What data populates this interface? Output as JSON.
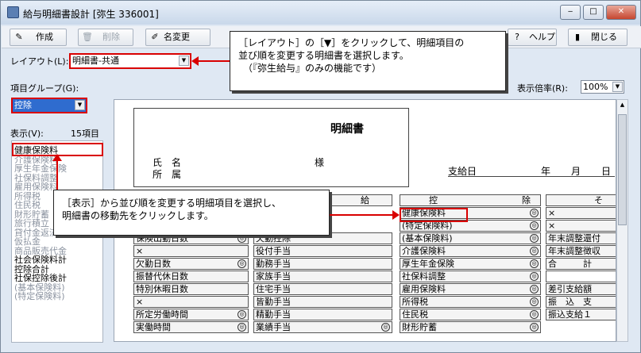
{
  "window": {
    "title": "給与明細書設計 [弥生 336001]",
    "min": "‒",
    "max": "□",
    "close": "✕"
  },
  "toolbar": {
    "create": "作成",
    "delete": "削除",
    "rename": "名変更",
    "help": "ヘルプ",
    "close": "閉じる"
  },
  "layout": {
    "label": "レイアウト(L):",
    "value": "明細書-共通"
  },
  "group": {
    "label": "項目グループ(G):",
    "value": "控除"
  },
  "display": {
    "label": "表示(V):",
    "count": "15項目"
  },
  "zoom": {
    "label": "表示倍率(R):",
    "value": "100%"
  },
  "items": [
    {
      "t": "健康保険料",
      "g": false
    },
    {
      "t": "介護保険料",
      "g": true
    },
    {
      "t": "厚生年金保険",
      "g": true
    },
    {
      "t": "社保料調整",
      "g": true
    },
    {
      "t": "雇用保険料",
      "g": true
    },
    {
      "t": "所得税",
      "g": true
    },
    {
      "t": "住民税",
      "g": true
    },
    {
      "t": "財形貯蓄",
      "g": true
    },
    {
      "t": "旅行積立",
      "g": true
    },
    {
      "t": "貸付金返済",
      "g": true
    },
    {
      "t": "仮払金",
      "g": true
    },
    {
      "t": "商品販売代金",
      "g": true
    },
    {
      "t": "社会保険料計",
      "g": false
    },
    {
      "t": "控除合計",
      "g": false
    },
    {
      "t": "社保控除後計",
      "g": false
    },
    {
      "t": "(基本保険料)",
      "g": true
    },
    {
      "t": "(特定保険料)",
      "g": true
    }
  ],
  "doc": {
    "title": "明細書",
    "name_label": "氏　名",
    "dept_label": "所　属",
    "sama": "様",
    "pay_date": "支給日",
    "year": "年",
    "month": "月",
    "day": "日"
  },
  "sections": {
    "pay": "給",
    "deduct_l": "控",
    "deduct_r": "除",
    "other": "そ"
  },
  "att_col": [
    "保険出勤日数",
    "×",
    "欠勤日数",
    "振替代休日数",
    "特別休暇日数",
    "×",
    "所定労働時間",
    "実働時間"
  ],
  "pay_col": [
    "欠勤控除",
    "役付手当",
    "勤務手当",
    "家族手当",
    "住宅手当",
    "皆勤手当",
    "精勤手当",
    "業績手当"
  ],
  "ded_col": [
    "健康保険料",
    "(特定保険料)",
    "(基本保険料)",
    "介護保険料",
    "厚生年金保険",
    "社保料調整",
    "雇用保険料",
    "所得税",
    "住民税",
    "財形貯蓄"
  ],
  "oth_col": [
    "×",
    "×",
    "年末調整還付",
    "年末調整徴収",
    "合　　　計",
    "",
    "差引支給額",
    "振　込　支",
    "振込支給１"
  ],
  "callouts": {
    "c1": [
      "［レイアウト］の［▼］をクリックして、明細項目の",
      "並び順を変更する明細書を選択します。",
      "（『弥生給与』のみの機能です）"
    ],
    "c2": [
      "［表示］から並び順を変更する明細項目を選択し、",
      "明細書の移動先をクリックします。"
    ]
  },
  "mark": "◎"
}
